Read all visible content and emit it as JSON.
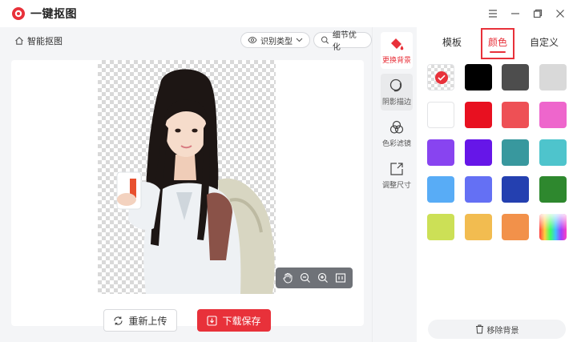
{
  "app": {
    "title": "一键抠图"
  },
  "toolbar": {
    "smart_label": "智能抠图",
    "type_label": "识别类型",
    "detail_label": "细节优化"
  },
  "actions": {
    "reupload": "重新上传",
    "save": "下载保存",
    "remove_bg": "移除背景"
  },
  "tools": [
    {
      "label": "更换背景"
    },
    {
      "label": "阴影描边"
    },
    {
      "label": "色彩滤镜"
    },
    {
      "label": "调整尺寸"
    }
  ],
  "tabs": [
    {
      "label": "模板"
    },
    {
      "label": "颜色"
    },
    {
      "label": "自定义"
    }
  ],
  "colors": {
    "accent": "#e8313a",
    "swatches": [
      {
        "name": "transparent",
        "value": "transparent",
        "selected": true
      },
      {
        "name": "black",
        "value": "#000000"
      },
      {
        "name": "dark-gray",
        "value": "#4d4d4d"
      },
      {
        "name": "light-gray",
        "value": "#d9d9d9"
      },
      {
        "name": "white",
        "value": "#ffffff"
      },
      {
        "name": "red",
        "value": "#e81020"
      },
      {
        "name": "coral",
        "value": "#ee5055"
      },
      {
        "name": "pink",
        "value": "#ee66cc"
      },
      {
        "name": "violet",
        "value": "#8844f0"
      },
      {
        "name": "purple",
        "value": "#6616e8"
      },
      {
        "name": "teal",
        "value": "#38989e"
      },
      {
        "name": "cyan",
        "value": "#4ec4cc"
      },
      {
        "name": "sky-blue",
        "value": "#58acf6"
      },
      {
        "name": "periwinkle",
        "value": "#6470f4"
      },
      {
        "name": "royal-blue",
        "value": "#2440b0"
      },
      {
        "name": "green",
        "value": "#2e882e"
      },
      {
        "name": "lime",
        "value": "#cce056"
      },
      {
        "name": "mustard",
        "value": "#f2bc50"
      },
      {
        "name": "orange",
        "value": "#f2914a"
      },
      {
        "name": "rainbow",
        "value": "gradient"
      }
    ]
  }
}
